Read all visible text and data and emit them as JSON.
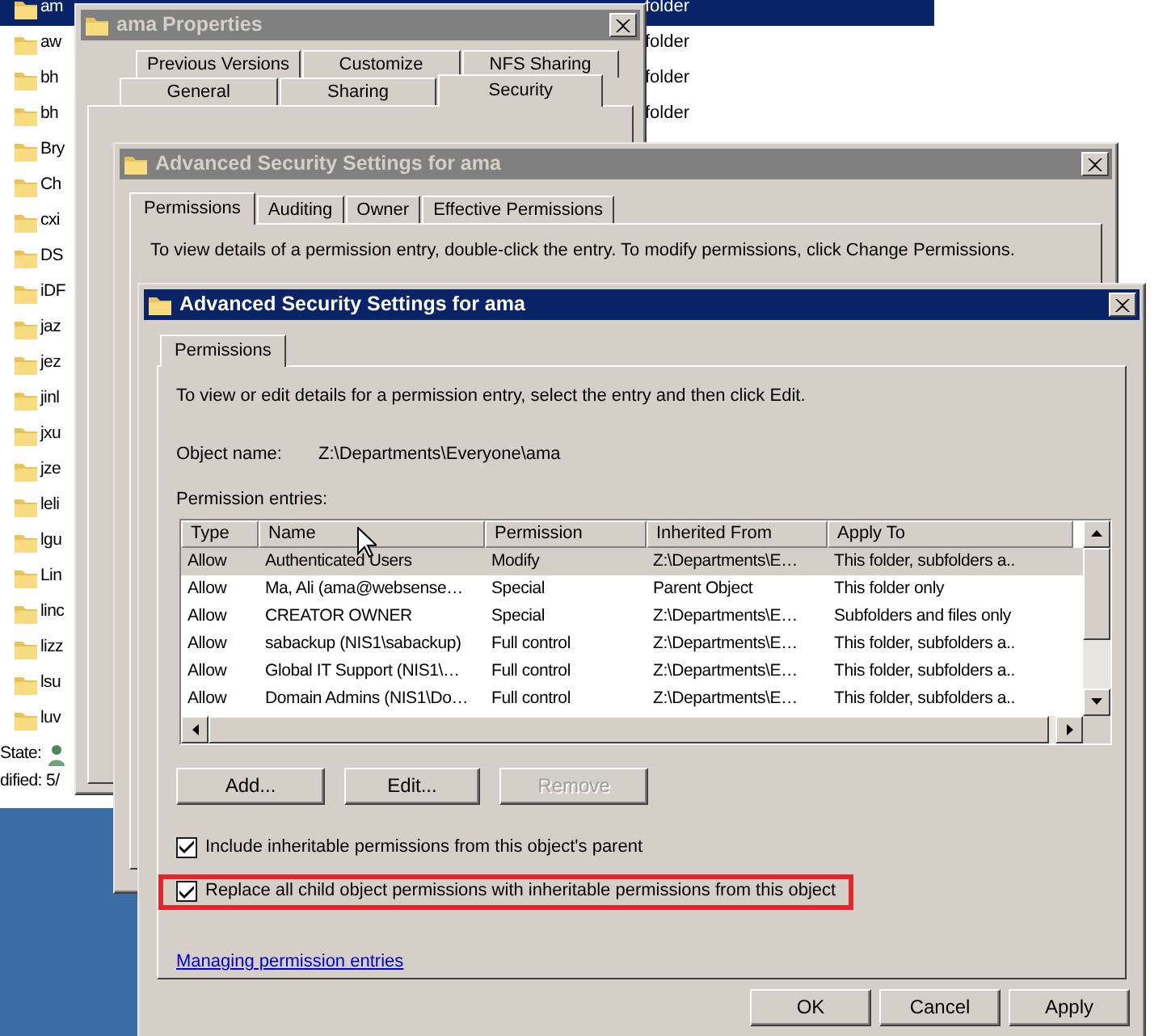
{
  "explorer": {
    "rows": [
      {
        "name": "am",
        "type": "folder",
        "selected": true
      },
      {
        "name": "aw",
        "type": "folder",
        "selected": false
      },
      {
        "name": "bh",
        "type": "folder",
        "selected": false
      },
      {
        "name": "bh",
        "type": "folder",
        "selected": false
      },
      {
        "name": "Bry",
        "selected": false
      },
      {
        "name": "Ch",
        "selected": false
      },
      {
        "name": "cxi",
        "selected": false
      },
      {
        "name": "DS",
        "selected": false
      },
      {
        "name": "iDF",
        "selected": false
      },
      {
        "name": "jaz",
        "selected": false
      },
      {
        "name": "jez",
        "selected": false
      },
      {
        "name": "jinl",
        "selected": false
      },
      {
        "name": "jxu",
        "selected": false
      },
      {
        "name": "jze",
        "selected": false
      },
      {
        "name": "leli",
        "selected": false
      },
      {
        "name": "lgu",
        "selected": false
      },
      {
        "name": "Lin",
        "selected": false
      },
      {
        "name": "linc",
        "selected": false
      },
      {
        "name": "lizz",
        "selected": false
      },
      {
        "name": "lsu",
        "selected": false
      },
      {
        "name": "luv",
        "selected": false
      }
    ],
    "details": [
      {
        "label": "State:",
        "kind": "state"
      },
      {
        "label": "dified: 5/",
        "kind": "text"
      }
    ]
  },
  "properties_window": {
    "title": "ama Properties",
    "active": false,
    "tab_rows": [
      [
        {
          "label": "Previous Versions",
          "selected": false
        },
        {
          "label": "Customize",
          "selected": false
        },
        {
          "label": "NFS Sharing",
          "selected": false
        }
      ],
      [
        {
          "label": "General",
          "selected": false
        },
        {
          "label": "Sharing",
          "selected": false
        },
        {
          "label": "Security",
          "selected": true
        }
      ]
    ]
  },
  "advanced_window": {
    "title": "Advanced Security Settings for ama",
    "active": false,
    "tabs": [
      {
        "label": "Permissions",
        "selected": true
      },
      {
        "label": "Auditing",
        "selected": false
      },
      {
        "label": "Owner",
        "selected": false
      },
      {
        "label": "Effective Permissions",
        "selected": false
      }
    ],
    "instructions": "To view details of a permission entry, double-click the entry. To modify permissions, click Change Permissions."
  },
  "permissions_dialog": {
    "title": "Advanced Security Settings for ama",
    "active": true,
    "tabs": [
      {
        "label": "Permissions",
        "selected": true
      }
    ],
    "instructions": "To view or edit details for a permission entry, select the entry and then click Edit.",
    "object_label": "Object name:",
    "object_name": "Z:\\Departments\\Everyone\\ama",
    "entries_label": "Permission entries:",
    "table": {
      "columns": [
        "Type",
        "Name",
        "Permission",
        "Inherited From",
        "Apply To"
      ],
      "rows": [
        {
          "cells": [
            "Allow",
            "Authenticated Users",
            "Modify",
            "Z:\\Departments\\E…",
            "This folder, subfolders a.."
          ],
          "selected": true
        },
        {
          "cells": [
            "Allow",
            "Ma, Ali (ama@websense…",
            "Special",
            "Parent Object",
            "This folder only"
          ],
          "selected": false
        },
        {
          "cells": [
            "Allow",
            "CREATOR OWNER",
            "Special",
            "Z:\\Departments\\E…",
            "Subfolders and files only"
          ],
          "selected": false
        },
        {
          "cells": [
            "Allow",
            "sabackup (NIS1\\sabackup)",
            "Full control",
            "Z:\\Departments\\E…",
            "This folder, subfolders a.."
          ],
          "selected": false
        },
        {
          "cells": [
            "Allow",
            "Global IT Support (NIS1\\…",
            "Full control",
            "Z:\\Departments\\E…",
            "This folder, subfolders a.."
          ],
          "selected": false
        },
        {
          "cells": [
            "Allow",
            "Domain Admins (NIS1\\Do…",
            "Full control",
            "Z:\\Departments\\E…",
            "This folder, subfolders a.."
          ],
          "selected": false
        }
      ]
    },
    "buttons": [
      {
        "label": "Add...",
        "disabled": false
      },
      {
        "label": "Edit...",
        "disabled": false
      },
      {
        "label": "Remove",
        "disabled": true
      }
    ],
    "options": [
      {
        "label": "Include inheritable permissions from this object's parent",
        "checked": true,
        "highlighted": false
      },
      {
        "label": "Replace all child object permissions with inheritable permissions from this object",
        "checked": true,
        "highlighted": true
      }
    ],
    "help_link": "Managing permission entries",
    "footer_buttons": [
      "OK",
      "Cancel",
      "Apply"
    ]
  }
}
